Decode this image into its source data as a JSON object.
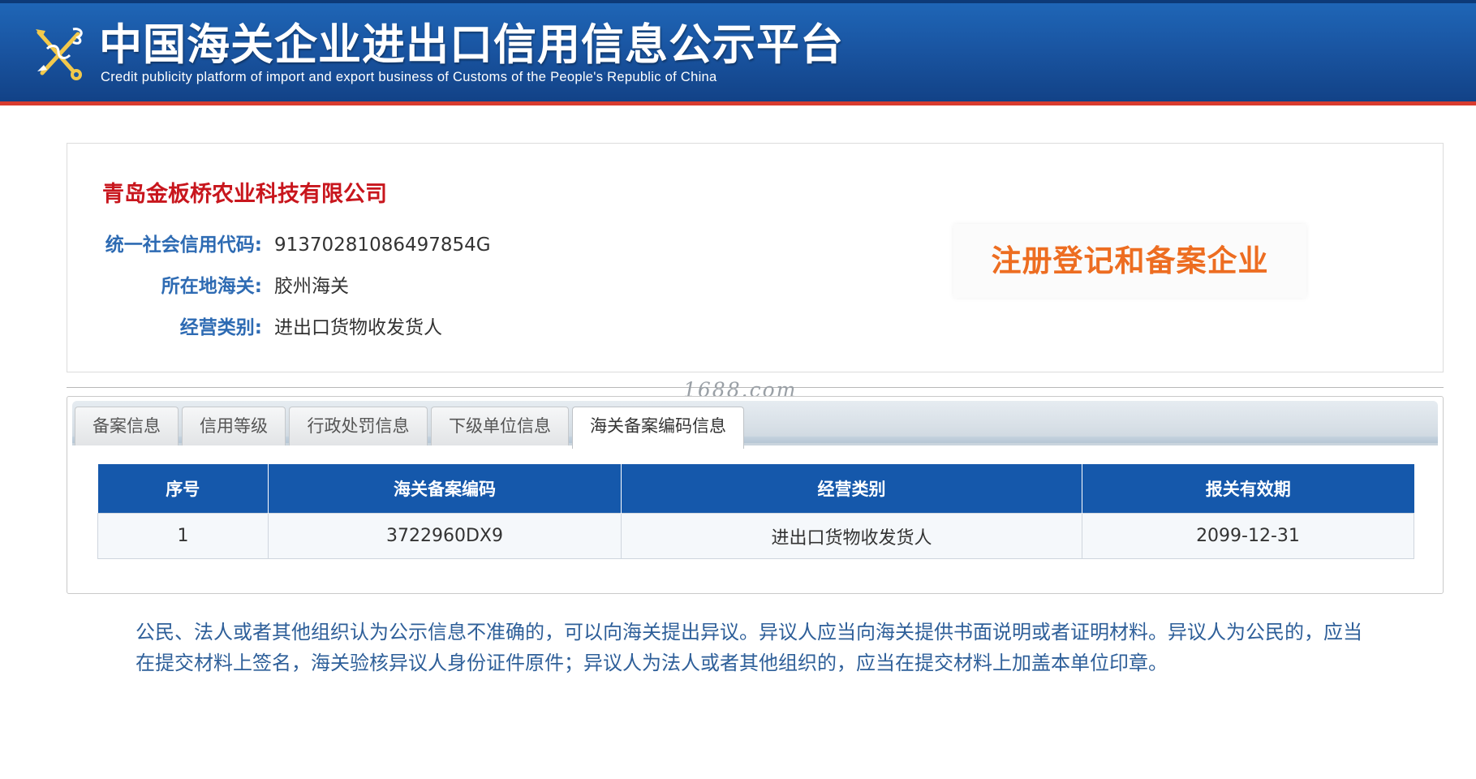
{
  "header": {
    "title": "中国海关企业进出口信用信息公示平台",
    "subtitle": "Credit publicity platform of import and export business of Customs of the People's Republic of China",
    "emblem_icon": "customs-emblem-icon"
  },
  "company": {
    "name": "青岛金板桥农业科技有限公司",
    "fields": [
      {
        "label": "统一社会信用代码:",
        "value": "91370281086497854G"
      },
      {
        "label": "所在地海关:",
        "value": "胶州海关"
      },
      {
        "label": "经营类别:",
        "value": "进出口货物收发货人"
      }
    ],
    "status_stamp": "注册登记和备案企业"
  },
  "watermark": "1688.com",
  "tabs": [
    {
      "label": "备案信息",
      "active": false
    },
    {
      "label": "信用等级",
      "active": false
    },
    {
      "label": "行政处罚信息",
      "active": false
    },
    {
      "label": "下级单位信息",
      "active": false
    },
    {
      "label": "海关备案编码信息",
      "active": true
    }
  ],
  "table": {
    "headers": [
      "序号",
      "海关备案编码",
      "经营类别",
      "报关有效期"
    ],
    "rows": [
      [
        "1",
        "3722960DX9",
        "进出口货物收发货人",
        "2099-12-31"
      ]
    ]
  },
  "notice": "公民、法人或者其他组织认为公示信息不准确的，可以向海关提出异议。异议人应当向海关提供书面说明或者证明材料。异议人为公民的，应当在提交材料上签名，海关验核异议人身份证件原件；异议人为法人或者其他组织的，应当在提交材料上加盖本单位印章。",
  "colors": {
    "banner": "#1a56a3",
    "banner_border": "#d83b2f",
    "company_name": "#c8161d",
    "label": "#2e6bb3",
    "stamp": "#ed6d21",
    "table_header": "#1558ab",
    "notice": "#2e5f99"
  }
}
